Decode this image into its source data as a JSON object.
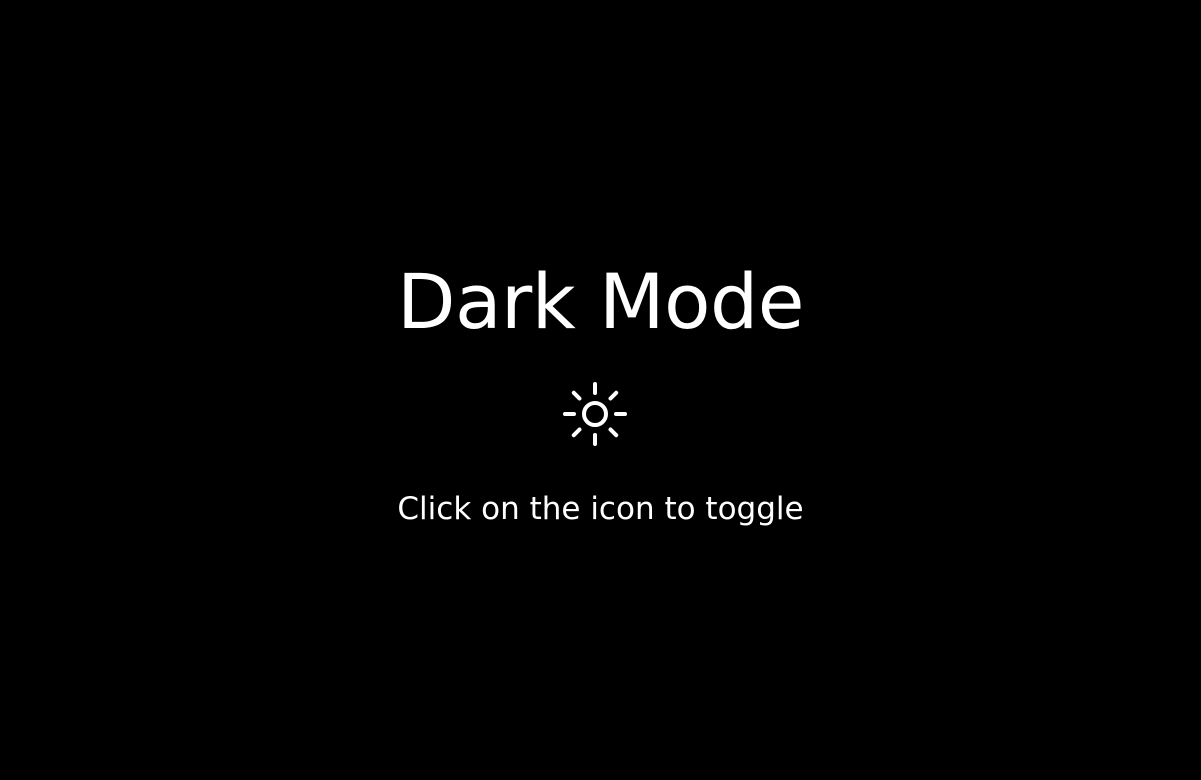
{
  "page": {
    "title": "Dark Mode",
    "hint": "Click on the icon to toggle"
  },
  "toggle": {
    "icon": "sun-icon"
  },
  "colors": {
    "background": "#000000",
    "foreground": "#ffffff"
  }
}
